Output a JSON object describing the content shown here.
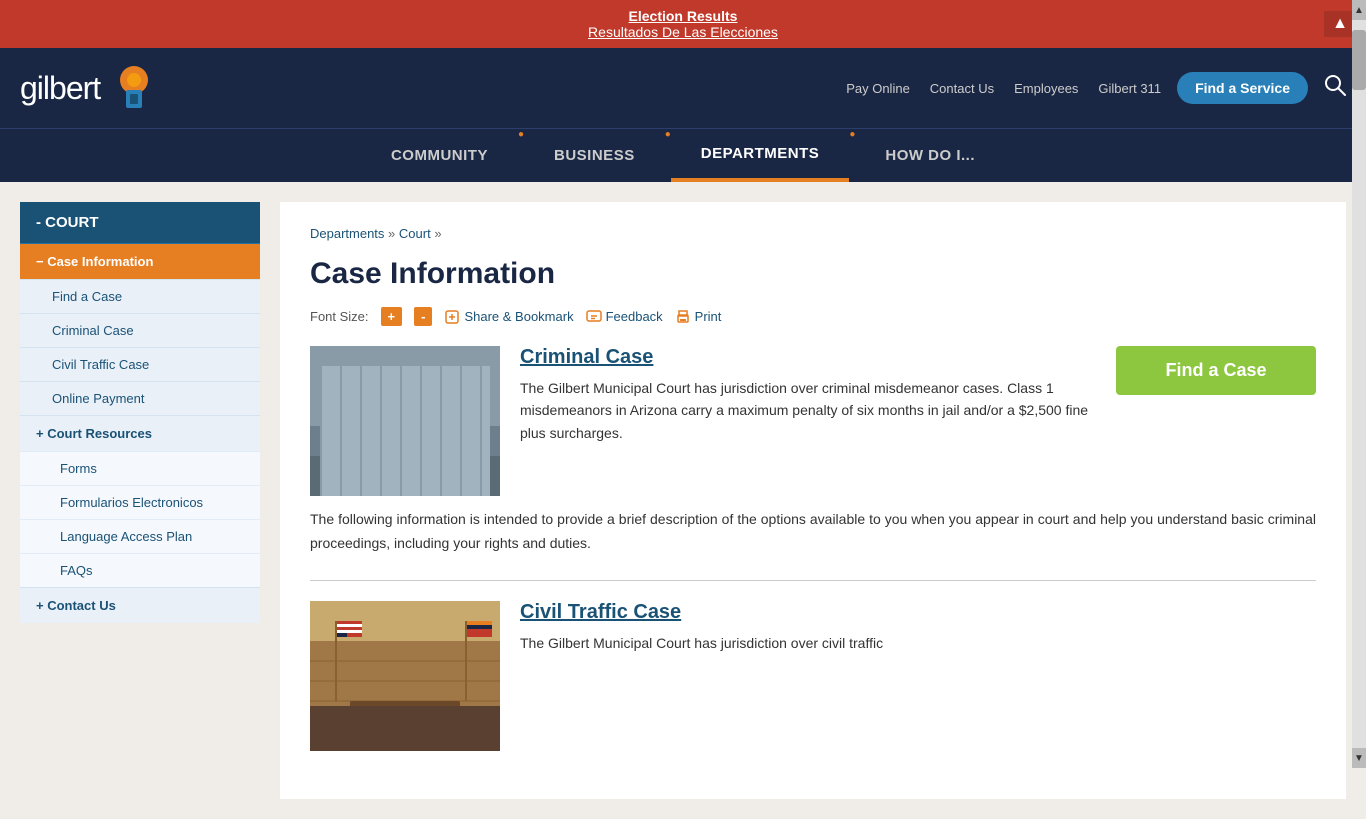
{
  "alert": {
    "line1": "Election Results",
    "line2": "Resultados De Las Elecciones",
    "collapse_label": "▲"
  },
  "header": {
    "logo_text": "gilbert",
    "links": [
      "Pay Online",
      "Contact Us",
      "Employees",
      "Gilbert 311"
    ],
    "find_service_label": "Find a Service",
    "search_label": "🔍"
  },
  "nav": {
    "items": [
      {
        "label": "COMMUNITY",
        "active": false
      },
      {
        "label": "BUSINESS",
        "active": false
      },
      {
        "label": "DEPARTMENTS",
        "active": true
      },
      {
        "label": "HOW DO I...",
        "active": false
      }
    ]
  },
  "sidebar": {
    "section_title": "- COURT",
    "items": [
      {
        "label": "- Case Information",
        "active": true,
        "type": "active"
      },
      {
        "label": "Find a Case",
        "type": "sub"
      },
      {
        "label": "Criminal Case",
        "type": "sub"
      },
      {
        "label": "Civil Traffic Case",
        "type": "sub"
      },
      {
        "label": "Online Payment",
        "type": "sub"
      },
      {
        "label": "+ Court Resources",
        "type": "group"
      },
      {
        "label": "Forms",
        "type": "child"
      },
      {
        "label": "Formularios Electronicos",
        "type": "child"
      },
      {
        "label": "Language Access Plan",
        "type": "child"
      },
      {
        "label": "FAQs",
        "type": "child"
      },
      {
        "label": "+ Contact Us",
        "type": "group"
      }
    ]
  },
  "breadcrumb": {
    "departments": "Departments",
    "court": "Court",
    "separator": "»"
  },
  "main": {
    "title": "Case Information",
    "font_size_label": "Font Size:",
    "font_plus": "+",
    "font_minus": "-",
    "share_label": "Share & Bookmark",
    "feedback_label": "Feedback",
    "print_label": "Print",
    "criminal_case": {
      "title": "Criminal Case",
      "find_btn": "Find a Case",
      "description": "The Gilbert Municipal Court has jurisdiction over criminal misdemeanor cases. Class 1 misdemeanors in Arizona carry a maximum penalty of six months in jail and/or a $2,500 fine plus surcharges."
    },
    "body_text": "The following information is intended to provide a brief description of the options available to you when you appear in court and help you understand basic criminal proceedings, including your rights and duties.",
    "civil_traffic": {
      "title": "Civil Traffic Case",
      "description": "The Gilbert Municipal Court has jurisdiction over civil traffic"
    }
  }
}
